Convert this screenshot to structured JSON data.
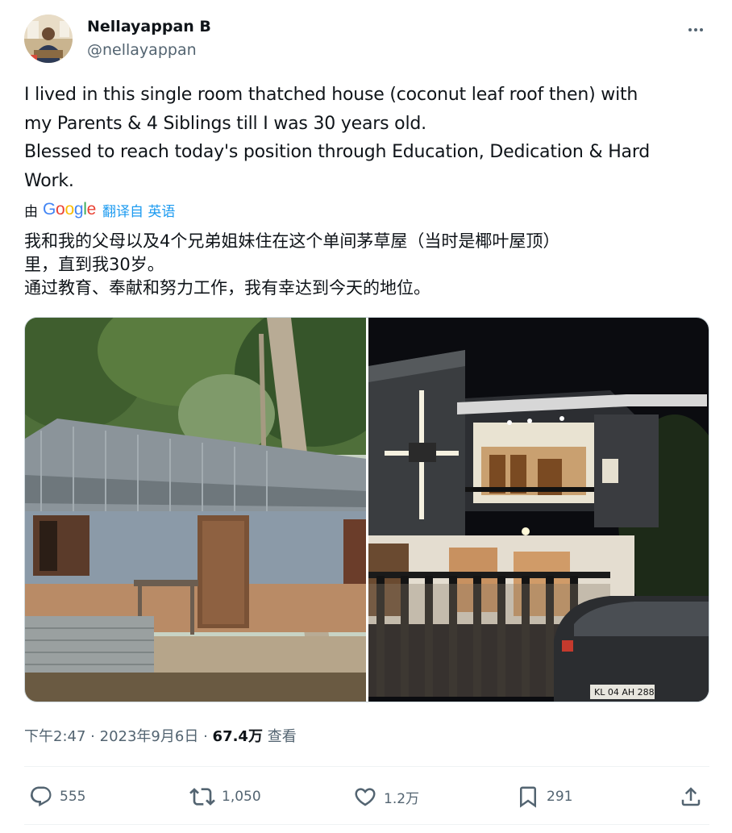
{
  "author": {
    "name": "Nellayappan B",
    "handle": "@nellayappan"
  },
  "tweet": {
    "line1": "I lived in this single room thatched house (coconut leaf roof then) with",
    "line2": "my Parents & 4 Siblings till I was 30 years old.",
    "line3": "Blessed to reach today's position through Education, Dedication & Hard",
    "line4": "Work."
  },
  "translation": {
    "by_label": "由",
    "provider": "Google",
    "link_text": "翻译自 英语",
    "line1": "我和我的父母以及4个兄弟姐妹住在这个单间茅草屋（当时是椰叶屋顶）",
    "line2": "里，直到我30岁。",
    "line3": "通过教育、奉献和努力工作，我有幸达到今天的地位。"
  },
  "media": {
    "photo1_icon": "old-house-photo",
    "photo2_icon": "new-house-photo",
    "car_plate": "KL 04 AH 288"
  },
  "meta": {
    "time": "下午2:47",
    "sep": "·",
    "date": "2023年9月6日",
    "views_count": "67.4万",
    "views_label": "查看"
  },
  "actions": {
    "replies": "555",
    "reposts": "1,050",
    "likes": "1.2万",
    "bookmarks": "291"
  },
  "colors": {
    "text": "#0f1419",
    "secondary": "#536471",
    "link": "#1d9bf0",
    "divider": "#eff3f4"
  }
}
